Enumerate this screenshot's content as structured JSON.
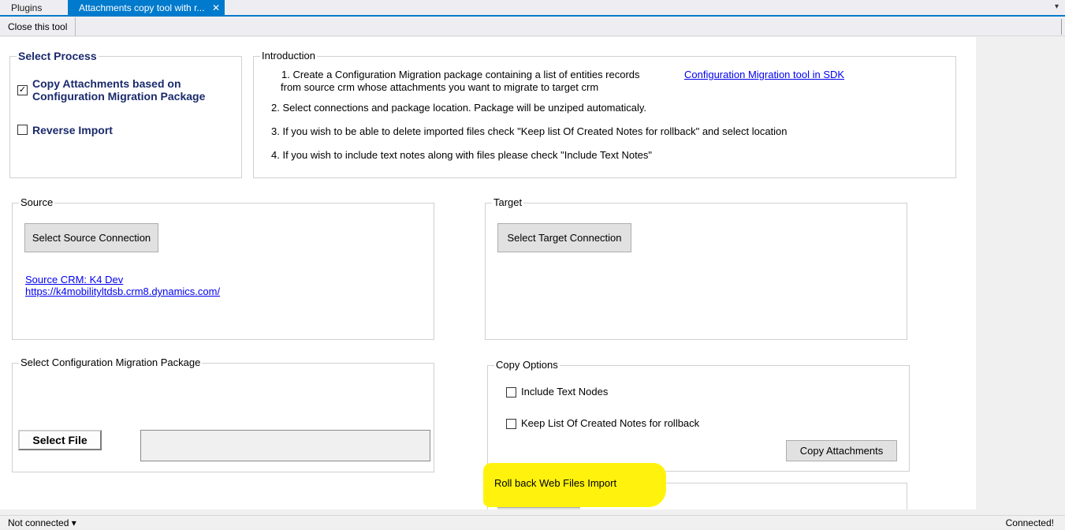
{
  "tabs": [
    {
      "label": "Plugins",
      "active": false
    },
    {
      "label": "Attachments copy tool with r...",
      "active": true,
      "close": "✕"
    }
  ],
  "tab_dropdown": "▾",
  "toolbar": {
    "close_tool": "Close this tool"
  },
  "select_process": {
    "title": "Select Process",
    "options": [
      {
        "label_line1": "Copy Attachments based on",
        "label_line2": "Configuration Migration Package",
        "checked": true
      },
      {
        "label": "Reverse Import",
        "checked": false
      }
    ]
  },
  "introduction": {
    "title": "Introduction",
    "step1_line1": "1. Create a Configuration Migration package containing a list of entities records",
    "step1_line2": "from  source crm whose attachments you want to migrate to target crm",
    "sdk_link": "Configuration Migration tool in SDK",
    "step2": "2. Select connections and package location. Package will be unziped automaticaly.",
    "step3": "3. If you wish to be able to delete imported files check \"Keep list Of Created Notes for rollback\" and select location",
    "step4": "4. If you wish to include text notes along with files please check \"Include Text Notes\""
  },
  "source": {
    "title": "Source",
    "button": "Select Source Connection",
    "crm_label": "Source CRM:    K4 Dev",
    "crm_url": "https://k4mobilityltdsb.crm8.dynamics.com/"
  },
  "target": {
    "title": "Target",
    "button": "Select Target Connection"
  },
  "package": {
    "title": "Select Configuration Migration Package",
    "button": "Select File"
  },
  "copy_options": {
    "title": "Copy Options",
    "include_text": "Include Text Nodes",
    "keep_list": "Keep List Of Created Notes for rollback",
    "include_text_checked": false,
    "keep_list_checked": false,
    "button": "Copy Attachments"
  },
  "rollback": {
    "title": "Roll back Web Files Import"
  },
  "status": {
    "left": "Not connected ▾",
    "right": "Connected!"
  },
  "colors": {
    "accent": "#007acc",
    "highlight": "#fff200",
    "link": "#0000ee",
    "heading": "#1a2a6c"
  }
}
